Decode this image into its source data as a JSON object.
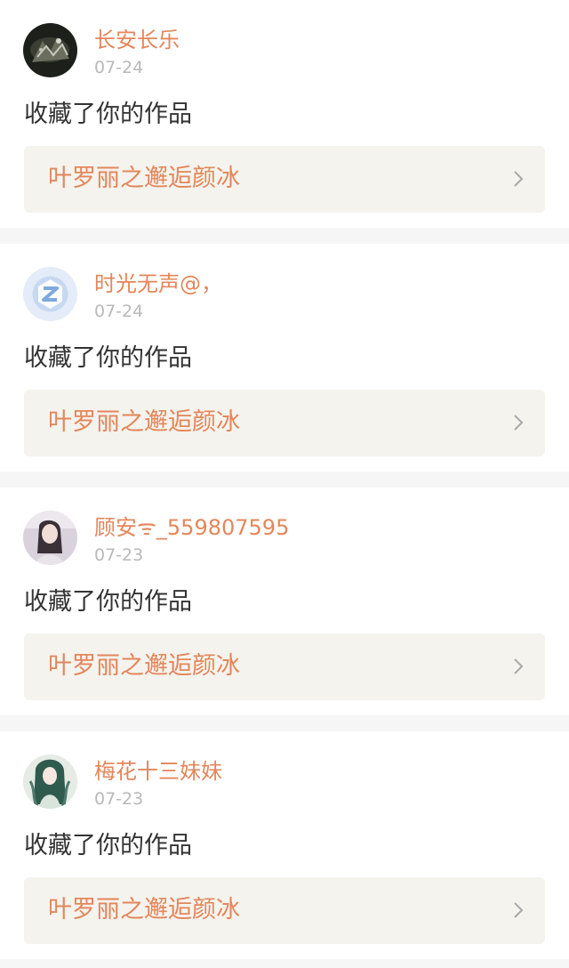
{
  "colors": {
    "accent": "#e4865a",
    "action_text": "#333333",
    "date_text": "#b9b9b9",
    "link_bg": "#f4f3ee",
    "separator": "#f6f6f6"
  },
  "notifications": [
    {
      "avatar_icon": "dark-nature-avatar",
      "username": "长安长乐",
      "date": "07-24",
      "action": "收藏了你的作品",
      "work_title": "叶罗丽之邂逅颜冰"
    },
    {
      "avatar_icon": "default-z-avatar",
      "username": "时光无声@，",
      "date": "07-24",
      "action": "收藏了你的作品",
      "work_title": "叶罗丽之邂逅颜冰"
    },
    {
      "avatar_icon": "girl-photo-avatar",
      "username": "顾安ᯤ_559807595",
      "date": "07-23",
      "action": "收藏了你的作品",
      "work_title": "叶罗丽之邂逅颜冰"
    },
    {
      "avatar_icon": "anime-girl-avatar",
      "username": "梅花十三妹妹",
      "date": "07-23",
      "action": "收藏了你的作品",
      "work_title": "叶罗丽之邂逅颜冰"
    }
  ]
}
